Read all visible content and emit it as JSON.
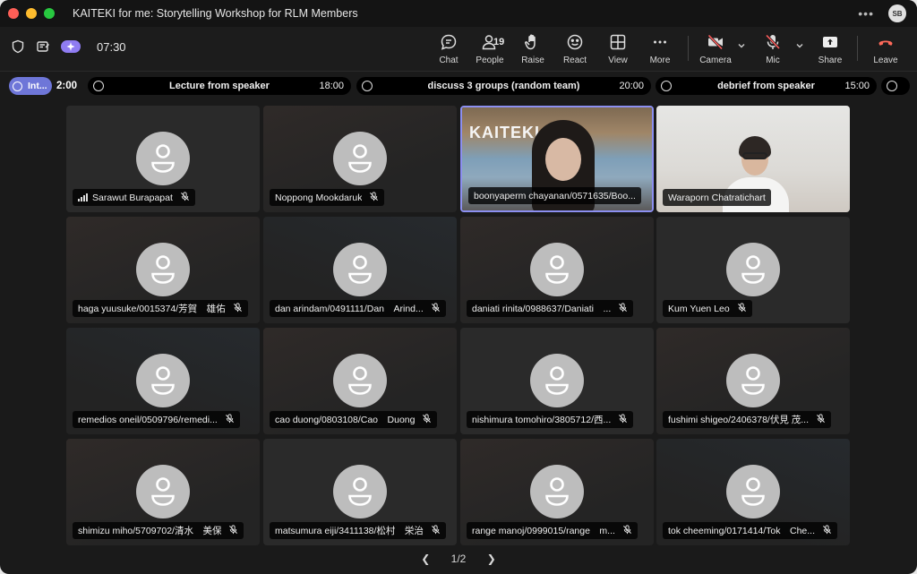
{
  "window": {
    "title": "KAITEKI for me: Storytelling Workshop for RLM Members",
    "user_initials": "SB"
  },
  "toolbar": {
    "time": "07:30",
    "buttons": {
      "chat": "Chat",
      "people": "People",
      "people_count": "19",
      "raise": "Raise",
      "react": "React",
      "view": "View",
      "more": "More",
      "camera": "Camera",
      "mic": "Mic",
      "share": "Share",
      "leave": "Leave"
    }
  },
  "agenda": {
    "current": {
      "label": "Int...",
      "timer": "2:00"
    },
    "items": [
      {
        "name": "Lecture from speaker",
        "duration": "18:00"
      },
      {
        "name": "discuss 3 groups (random team)",
        "duration": "20:00"
      },
      {
        "name": "debrief from speaker",
        "duration": "15:00"
      }
    ]
  },
  "participants": [
    {
      "name": "Sarawut Burapapat",
      "muted": true,
      "signal": true,
      "video": false
    },
    {
      "name": "Noppong Mookdaruk",
      "muted": true,
      "video": false
    },
    {
      "name": "boonyaperm chayanan/0571635/Boo...",
      "muted": false,
      "video": true,
      "active": true,
      "screen_text": "KAITEKI"
    },
    {
      "name": "Waraporn Chatratichart",
      "muted": false,
      "video": true
    },
    {
      "name": "haga yuusuke/0015374/芳賀　雄佑",
      "muted": true,
      "video": false
    },
    {
      "name": "dan arindam/0491111/Dan　Arind...",
      "muted": true,
      "video": false
    },
    {
      "name": "daniati rinita/0988637/Daniati　...",
      "muted": true,
      "video": false
    },
    {
      "name": "Kum Yuen Leo",
      "muted": true,
      "video": false
    },
    {
      "name": "remedios oneil/0509796/remedi...",
      "muted": true,
      "video": false
    },
    {
      "name": "cao duong/0803108/Cao　Duong",
      "muted": true,
      "video": false
    },
    {
      "name": "nishimura tomohiro/3805712/西...",
      "muted": true,
      "video": false
    },
    {
      "name": "fushimi shigeo/2406378/伏見 茂...",
      "muted": true,
      "video": false
    },
    {
      "name": "shimizu miho/5709702/清水　美保",
      "muted": true,
      "video": false
    },
    {
      "name": "matsumura eiji/3411138/松村　栄治",
      "muted": true,
      "video": false
    },
    {
      "name": "range manoj/0999015/range　m...",
      "muted": true,
      "video": false
    },
    {
      "name": "tok cheeming/0171414/Tok　Che...",
      "muted": true,
      "video": false
    }
  ],
  "pager": {
    "label": "1/2"
  },
  "colors": {
    "accent": "#8c8ff0",
    "agenda_active": "#6e76d8",
    "leave": "#ff6a5a"
  }
}
